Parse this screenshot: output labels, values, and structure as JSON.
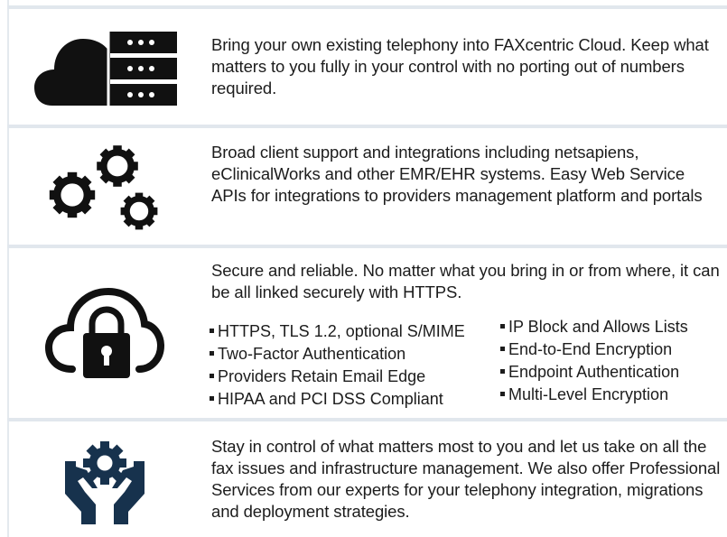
{
  "sections": [
    {
      "icon": "cloud-server-icon",
      "text": "Bring your own existing telephony into FAXcentric Cloud. Keep what matters to you fully in your control with no porting out of numbers required."
    },
    {
      "icon": "gears-icon",
      "text": "Broad client support and integrations including netsapiens, eClinicalWorks and other EMR/EHR systems. Easy Web Service APIs for integrations to providers management platform and portals"
    },
    {
      "icon": "cloud-lock-icon",
      "text": "Secure and reliable. No matter what you bring in or from where, it can be all linked securely with HTTPS.",
      "bullets_left": [
        "HTTPS, TLS 1.2, optional S/MIME",
        "Two-Factor Authentication",
        "Providers Retain Email Edge",
        "HIPAA and PCI DSS Compliant"
      ],
      "bullets_right": [
        "IP Block and Allows Lists",
        "End-to-End Encryption",
        "Endpoint Authentication",
        "Multi-Level Encryption"
      ]
    },
    {
      "icon": "hands-gear-icon",
      "text": "Stay in control of what matters most to you and let us take on all the fax issues and infrastructure management. We also offer Professional Services from our experts for your telephony integration, migrations and deployment strategies."
    }
  ],
  "colors": {
    "icon_dark": "#111111",
    "icon_navy": "#17324d",
    "separator": "#e1e7ed"
  }
}
